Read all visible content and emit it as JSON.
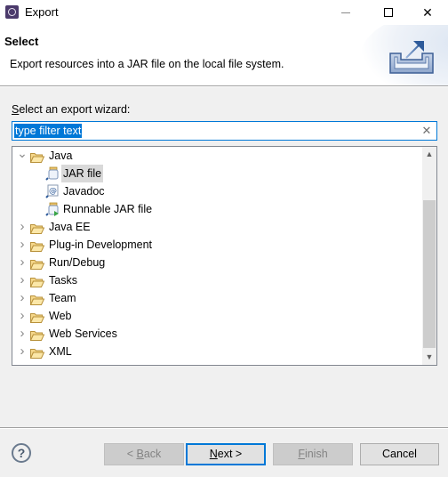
{
  "window": {
    "title": "Export",
    "app_icon": "eclipse-icon",
    "controls": {
      "minimize": "minimize-icon",
      "maximize": "maximize-icon",
      "close": "close-icon"
    }
  },
  "header": {
    "title": "Select",
    "description": "Export resources into a JAR file on the local file system.",
    "icon": "export-icon"
  },
  "wizard": {
    "label_mnemonic": "S",
    "label_rest": "elect an export wizard:",
    "filter": {
      "value": "type filter text",
      "clear_icon": "clear-icon"
    }
  },
  "tree": {
    "items": [
      {
        "label": "Java",
        "expanded": true,
        "level": 0,
        "icon": "folder-open-icon"
      },
      {
        "label": "JAR file",
        "level": 1,
        "icon": "jar-icon",
        "selected": true
      },
      {
        "label": "Javadoc",
        "level": 1,
        "icon": "javadoc-icon"
      },
      {
        "label": "Runnable JAR file",
        "level": 1,
        "icon": "runnable-jar-icon"
      },
      {
        "label": "Java EE",
        "expanded": false,
        "level": 0,
        "icon": "folder-icon"
      },
      {
        "label": "Plug-in Development",
        "expanded": false,
        "level": 0,
        "icon": "folder-icon"
      },
      {
        "label": "Run/Debug",
        "expanded": false,
        "level": 0,
        "icon": "folder-icon"
      },
      {
        "label": "Tasks",
        "expanded": false,
        "level": 0,
        "icon": "folder-icon"
      },
      {
        "label": "Team",
        "expanded": false,
        "level": 0,
        "icon": "folder-icon"
      },
      {
        "label": "Web",
        "expanded": false,
        "level": 0,
        "icon": "folder-icon"
      },
      {
        "label": "Web Services",
        "expanded": false,
        "level": 0,
        "icon": "folder-icon"
      },
      {
        "label": "XML",
        "expanded": false,
        "level": 0,
        "icon": "folder-icon"
      }
    ]
  },
  "footer": {
    "help_icon": "help-icon",
    "back": {
      "prefix": "< ",
      "mnemonic": "B",
      "rest": "ack",
      "enabled": false
    },
    "next": {
      "mnemonic": "N",
      "rest": "ext >",
      "enabled": true,
      "default": true
    },
    "finish": {
      "mnemonic": "F",
      "rest": "inish",
      "enabled": false
    },
    "cancel": {
      "label": "Cancel",
      "enabled": true
    }
  },
  "colors": {
    "accent": "#0078d7",
    "selection_bg": "#d9d9d9",
    "disabled_button_bg": "#cccccc",
    "dialog_bg": "#f0f0f0"
  }
}
